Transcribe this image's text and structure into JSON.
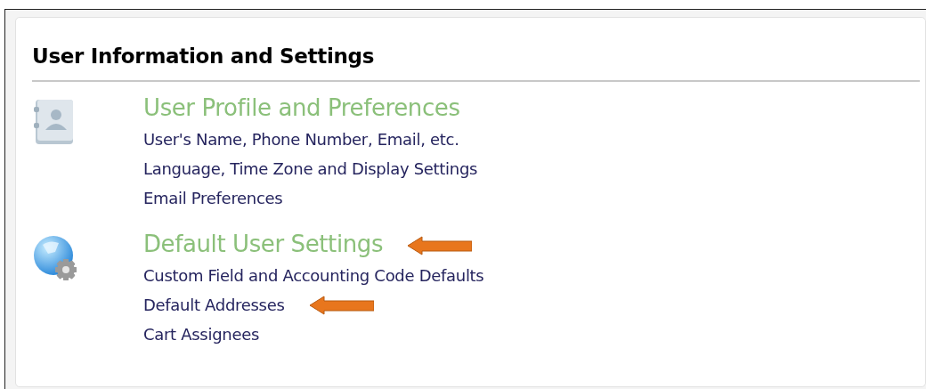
{
  "title": "User Information and Settings",
  "sections": [
    {
      "kind": "profile",
      "heading": "User Profile and Preferences",
      "arrow": false,
      "links": [
        {
          "label": "User's Name, Phone Number, Email, etc.",
          "arrow": false
        },
        {
          "label": "Language, Time Zone and Display Settings",
          "arrow": false
        },
        {
          "label": "Email Preferences",
          "arrow": false
        }
      ]
    },
    {
      "kind": "globe",
      "heading": "Default User Settings",
      "arrow": true,
      "links": [
        {
          "label": "Custom Field and Accounting Code Defaults",
          "arrow": false
        },
        {
          "label": "Default Addresses",
          "arrow": true
        },
        {
          "label": "Cart Assignees",
          "arrow": false
        }
      ]
    }
  ]
}
